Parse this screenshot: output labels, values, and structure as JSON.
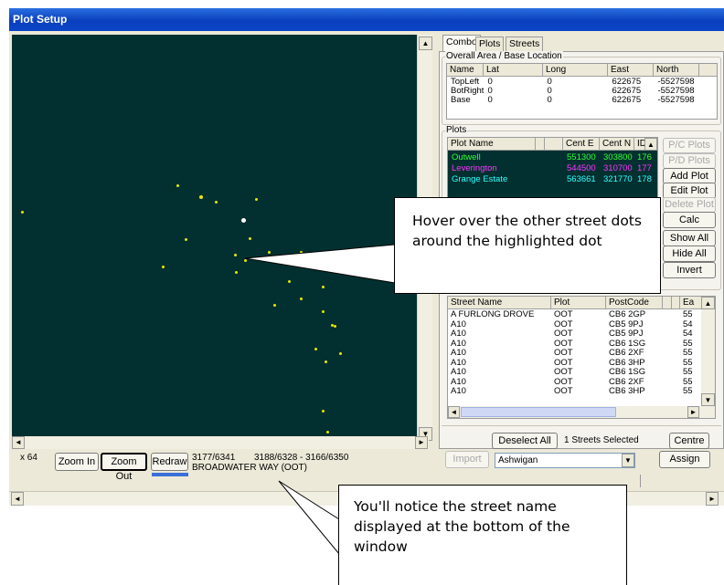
{
  "window": {
    "title": "Plot Setup"
  },
  "tabs": [
    {
      "label": "Combo",
      "active": true
    },
    {
      "label": "Plots",
      "active": false
    },
    {
      "label": "Streets",
      "active": false
    }
  ],
  "overall": {
    "group_label": "Overall Area / Base Location",
    "headers": [
      "Name",
      "Lat",
      "Long",
      "East",
      "North"
    ],
    "rows": [
      {
        "name": "TopLeft",
        "lat": "0",
        "long": "0",
        "east": "622675",
        "north": "-5527598"
      },
      {
        "name": "BotRight",
        "lat": "0",
        "long": "0",
        "east": "622675",
        "north": "-5527598"
      },
      {
        "name": "Base",
        "lat": "0",
        "long": "0",
        "east": "622675",
        "north": "-5527598"
      }
    ]
  },
  "plots": {
    "group_label": "Plots",
    "headers": [
      "Plot Name",
      "Cent E",
      "Cent N",
      "ID"
    ],
    "rows": [
      {
        "name": "Outwell",
        "cent_e": "551300",
        "cent_n": "303800",
        "id": "176",
        "color": "#33ff33"
      },
      {
        "name": "Leverington",
        "cent_e": "544500",
        "cent_n": "310700",
        "id": "177",
        "color": "#ff33ff"
      },
      {
        "name": "Grange Estate",
        "cent_e": "563661",
        "cent_n": "321770",
        "id": "178",
        "color": "#33ffff"
      }
    ],
    "buttons": [
      {
        "label": "P/C Plots",
        "enabled": false
      },
      {
        "label": "P/D Plots",
        "enabled": false
      },
      {
        "label": "Add Plot",
        "enabled": true
      },
      {
        "label": "Edit Plot",
        "enabled": true
      },
      {
        "label": "Delete Plot",
        "enabled": false
      },
      {
        "label": "Calc Centres",
        "enabled": true
      },
      {
        "label": "Show All",
        "enabled": true
      },
      {
        "label": "Hide All",
        "enabled": true
      },
      {
        "label": "Invert",
        "enabled": true
      }
    ]
  },
  "streets": {
    "headers": [
      "Street Name",
      "Plot",
      "PostCode",
      "Ea"
    ],
    "rows": [
      {
        "name": "A FURLONG DROVE",
        "plot": "OOT",
        "postcode": "CB6 2GP",
        "east": "55"
      },
      {
        "name": "A10",
        "plot": "OOT",
        "postcode": "CB5 9PJ",
        "east": "54"
      },
      {
        "name": "A10",
        "plot": "OOT",
        "postcode": "CB5 9PJ",
        "east": "54"
      },
      {
        "name": "A10",
        "plot": "OOT",
        "postcode": "CB6 1SG",
        "east": "55"
      },
      {
        "name": "A10",
        "plot": "OOT",
        "postcode": "CB6 2XF",
        "east": "55"
      },
      {
        "name": "A10",
        "plot": "OOT",
        "postcode": "CB6 3HP",
        "east": "55"
      },
      {
        "name": "A10",
        "plot": "OOT",
        "postcode": "CB6 1SG",
        "east": "55"
      },
      {
        "name": "A10",
        "plot": "OOT",
        "postcode": "CB6 2XF",
        "east": "55"
      },
      {
        "name": "A10",
        "plot": "OOT",
        "postcode": "CB6 3HP",
        "east": "55"
      }
    ],
    "deselect_label": "Deselect All",
    "selected_text": "1 Streets Selected",
    "centre_label": "Centre",
    "import_label": "Import",
    "area_value": "Ashwigan",
    "assign_label": "Assign"
  },
  "bottombar": {
    "zoom_text": "x 64",
    "zoom_in": "Zoom In",
    "zoom_out": "Zoom Out",
    "redraw": "Redraw",
    "coords_1": "3177/6341",
    "coords_2": "3188/6328 - 3166/6350",
    "street_name": "BROADWATER WAY (OOT)"
  },
  "callouts": {
    "hover": "Hover over the other street dots around the highlighted dot",
    "notice": "You'll notice the street name displayed at the bottom of the window"
  },
  "colors": {
    "plot_background": "#023030",
    "street_dot": "#e8e800",
    "highlight_dot": "#ffffff",
    "titlebar": "#0a3fbd"
  }
}
